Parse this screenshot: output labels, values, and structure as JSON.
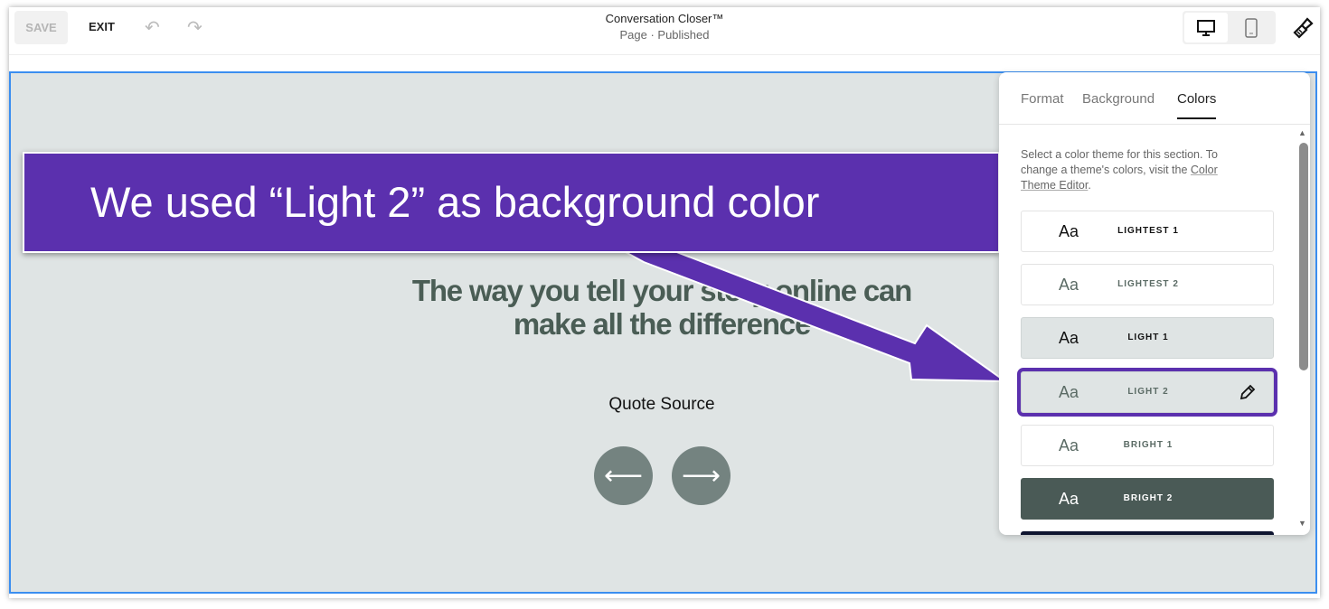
{
  "toolbar": {
    "save": "SAVE",
    "exit": "EXIT",
    "title": "Conversation Closer™",
    "subtitle": "Page · Published"
  },
  "section": {
    "quote_line1": "The way you tell your story online can",
    "quote_line2": "make all the difference",
    "source": "Quote Source",
    "prev": "⟵",
    "next": "⟶",
    "background": "#dfe4e4"
  },
  "annotation": {
    "text": "We used “Light 2” as background color",
    "color": "#5b30ae"
  },
  "panel": {
    "tabs": [
      "Format",
      "Background",
      "Colors"
    ],
    "active_tab": "Colors",
    "desc_prefix": "Select a color theme for this section. To change a theme's colors, visit the ",
    "desc_link": "Color Theme Editor",
    "desc_suffix": ".",
    "themes": [
      {
        "label": "LIGHTEST 1",
        "aa": "Aa",
        "bg": "#ffffff",
        "fg": "#111111"
      },
      {
        "label": "LIGHTEST 2",
        "aa": "Aa",
        "bg": "#ffffff",
        "fg": "#5b6b65"
      },
      {
        "label": "LIGHT 1",
        "aa": "Aa",
        "bg": "#dfe4e4",
        "fg": "#111111"
      },
      {
        "label": "LIGHT 2",
        "aa": "Aa",
        "bg": "#dfe4e4",
        "fg": "#5b6b65",
        "selected": true
      },
      {
        "label": "BRIGHT 1",
        "aa": "Aa",
        "bg": "#ffffff",
        "fg": "#5b6b65"
      },
      {
        "label": "BRIGHT 2",
        "aa": "Aa",
        "bg": "#4a5a56",
        "fg": "#ffffff"
      },
      {
        "label": "",
        "aa": "",
        "bg": "#0e1530",
        "fg": "#ffffff"
      }
    ]
  }
}
